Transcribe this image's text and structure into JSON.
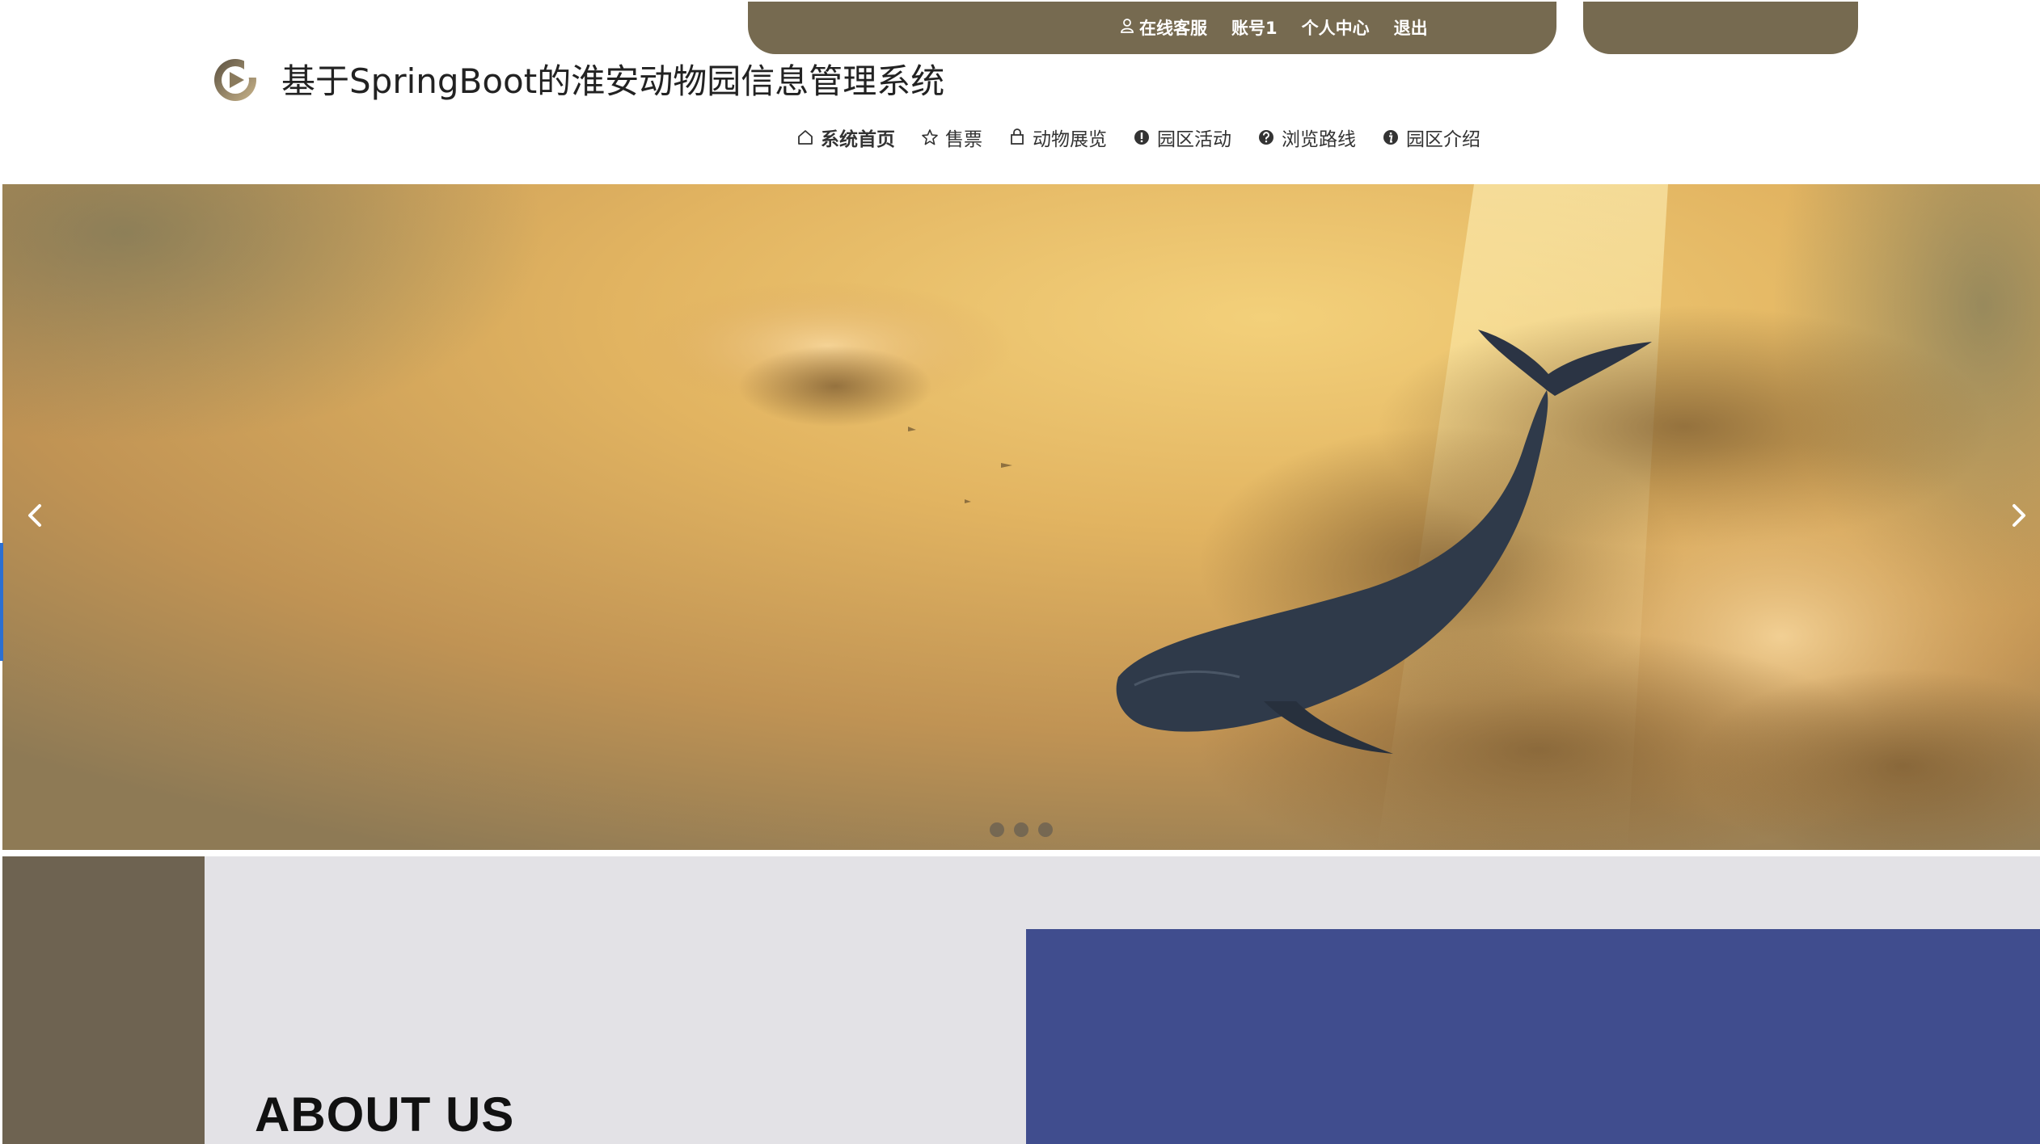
{
  "top_links": {
    "customer_service": "在线客服",
    "account": "账号1",
    "personal_center": "个人中心",
    "logout": "退出"
  },
  "site": {
    "title": "基于SpringBoot的淮安动物园信息管理系统"
  },
  "nav": {
    "home": "系统首页",
    "tickets": "售票",
    "animals": "动物展览",
    "activities": "园区活动",
    "routes": "浏览路线",
    "intro": "园区介绍"
  },
  "carousel": {
    "slide_count": 3,
    "active_index": 0
  },
  "about": {
    "title": "ABOUT US"
  },
  "colors": {
    "brand": "#766a50",
    "stripe": "#6e6351",
    "section_bg": "#e3e2e6",
    "accent_blue": "#404d8e"
  },
  "icons": {
    "customer_service": "user-icon",
    "home": "home-icon",
    "tickets": "star-icon",
    "animals": "bag-icon",
    "activities": "exclamation-circle-icon",
    "routes": "question-circle-icon",
    "intro": "info-circle-icon",
    "prev": "chevron-left-icon",
    "next": "chevron-right-icon"
  }
}
